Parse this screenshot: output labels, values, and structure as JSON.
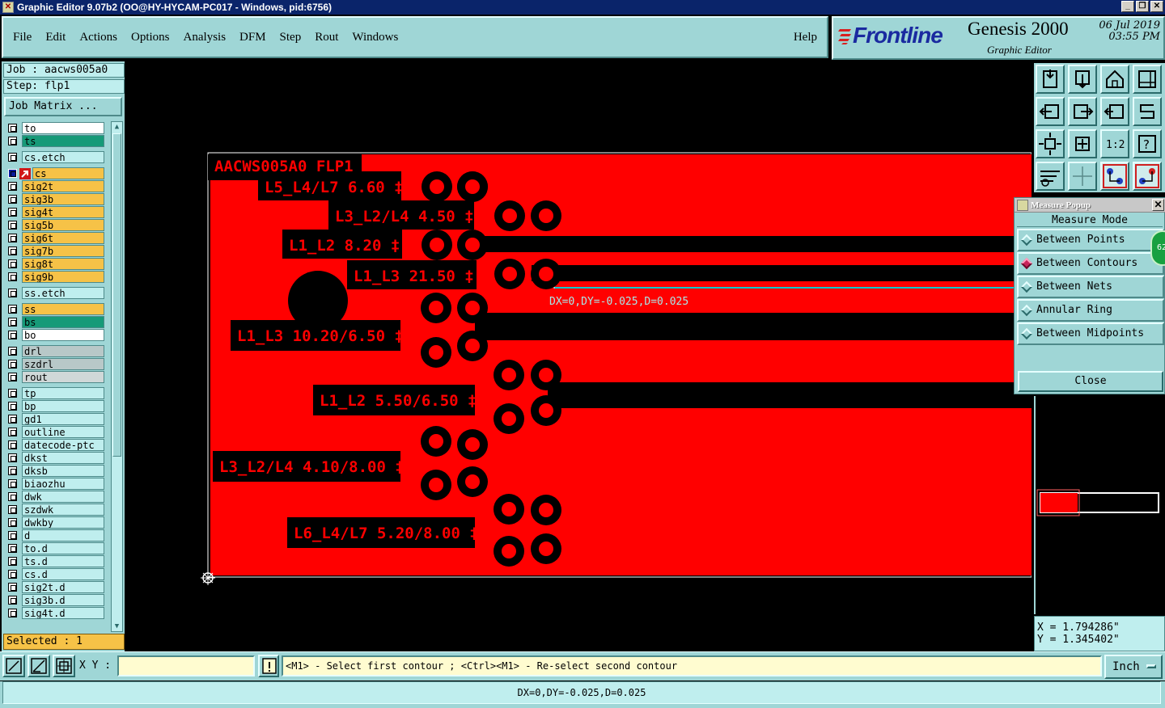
{
  "titlebar": {
    "title": "Graphic Editor 9.07b2 (OO@HY-HYCAM-PC017 - Windows, pid:6756)"
  },
  "menu": {
    "items": [
      "File",
      "Edit",
      "Actions",
      "Options",
      "Analysis",
      "DFM",
      "Step",
      "Rout",
      "Windows"
    ],
    "help": "Help"
  },
  "brand": {
    "logo": "Frontline",
    "product": "Genesis 2000",
    "subtitle": "Graphic Editor",
    "date": "06 Jul 2019",
    "time": "03:55 PM"
  },
  "job": {
    "job_line": "Job : aacws005a0",
    "step_line": "Step: flp1",
    "matrix_button": "Job Matrix ..."
  },
  "layers": [
    {
      "name": "to",
      "color": "#ffffff"
    },
    {
      "name": "ts",
      "color": "#169a78"
    },
    {
      "name": "cs.etch",
      "color": "#bfeeee"
    },
    {
      "name": "cs",
      "color": "#f6c247",
      "work": true
    },
    {
      "name": "sig2t",
      "color": "#f6c247"
    },
    {
      "name": "sig3b",
      "color": "#f6c247"
    },
    {
      "name": "sig4t",
      "color": "#f6c247"
    },
    {
      "name": "sig5b",
      "color": "#f6c247"
    },
    {
      "name": "sig6t",
      "color": "#f6c247"
    },
    {
      "name": "sig7b",
      "color": "#f6c247"
    },
    {
      "name": "sig8t",
      "color": "#f6c247"
    },
    {
      "name": "sig9b",
      "color": "#f6c247"
    },
    {
      "name": "ss.etch",
      "color": "#bfeeee"
    },
    {
      "name": "ss",
      "color": "#f6c247"
    },
    {
      "name": "bs",
      "color": "#169a78"
    },
    {
      "name": "bo",
      "color": "#ffffff"
    },
    {
      "name": "drl",
      "color": "#b8c8c8"
    },
    {
      "name": "szdrl",
      "color": "#b8c8c8"
    },
    {
      "name": "rout",
      "color": "#d0d8d8"
    },
    {
      "name": "tp",
      "color": "#bfeeee"
    },
    {
      "name": "bp",
      "color": "#bfeeee"
    },
    {
      "name": "gd1",
      "color": "#bfeeee"
    },
    {
      "name": "outline",
      "color": "#bfeeee"
    },
    {
      "name": "datecode-ptc",
      "color": "#bfeeee"
    },
    {
      "name": "dkst",
      "color": "#bfeeee"
    },
    {
      "name": "dksb",
      "color": "#bfeeee"
    },
    {
      "name": "biaozhu",
      "color": "#bfeeee"
    },
    {
      "name": "dwk",
      "color": "#bfeeee"
    },
    {
      "name": "szdwk",
      "color": "#bfeeee"
    },
    {
      "name": "dwkby",
      "color": "#bfeeee"
    },
    {
      "name": "d",
      "color": "#bfeeee"
    },
    {
      "name": "to.d",
      "color": "#bfeeee"
    },
    {
      "name": "ts.d",
      "color": "#bfeeee"
    },
    {
      "name": "cs.d",
      "color": "#bfeeee"
    },
    {
      "name": "sig2t.d",
      "color": "#bfeeee"
    },
    {
      "name": "sig3b.d",
      "color": "#bfeeee"
    },
    {
      "name": "sig4t.d",
      "color": "#bfeeee"
    }
  ],
  "selected": "Selected : 1",
  "canvas": {
    "board_label": "AACWS005A0 FLP1",
    "labels": [
      "L5_L4/L7 6.60 ‡",
      "L3_L2/L4 4.50 ‡",
      "L1_L2 8.20 ‡",
      "L1_L3 21.50 ‡",
      "L1_L3 10.20/6.50 ‡",
      "L1_L2 5.50/6.50 ‡",
      "L3_L2/L4 4.10/8.00 ‡",
      "L6_L4/L7 5.20/8.00 ‡"
    ],
    "measure_text": "DX=0,DY=-0.025,D=0.025",
    "board_color": "#ff0000"
  },
  "measure_popup": {
    "title": "Measure Popup",
    "heading": "Measure Mode",
    "options": [
      "Between Points",
      "Between Contours",
      "Between Nets",
      "Annular Ring",
      "Between Midpoints"
    ],
    "selected_index": 1,
    "close_label": "Close",
    "badge": "62"
  },
  "coords": {
    "x": "X = 1.794286\"",
    "y": "Y = 1.345402\""
  },
  "bottom": {
    "xy_label": "X Y :",
    "xy_value": "",
    "prompt": "<M1> - Select first contour ; <Ctrl><M1> - Re-select second contour",
    "unit": "Inch"
  },
  "status": "DX=0,DY=-0.025,D=0.025"
}
